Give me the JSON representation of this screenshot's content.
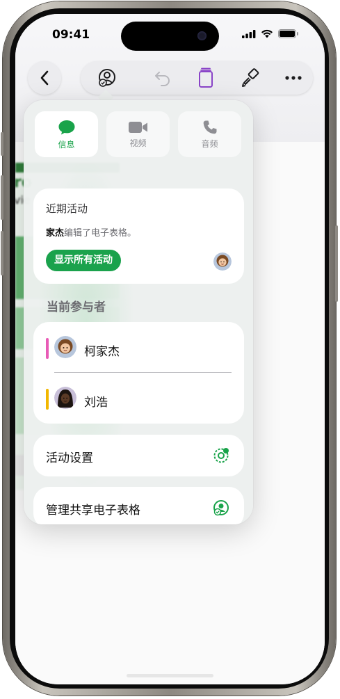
{
  "status_bar": {
    "time": "09:41"
  },
  "toolbar": {
    "back_icon": "chevron-left-icon",
    "items": [
      "collaboration-icon",
      "undo-icon",
      "format-pane-icon",
      "paintbrush-icon",
      "more-icon"
    ]
  },
  "popover": {
    "tabs": [
      {
        "label": "信息",
        "icon": "message-bubble-icon",
        "active": true
      },
      {
        "label": "视频",
        "icon": "video-camera-icon",
        "active": false
      },
      {
        "label": "音频",
        "icon": "phone-icon",
        "active": false
      }
    ],
    "recent_activity": {
      "title": "近期活动",
      "actor": "家杰",
      "action": "编辑了电子表格。",
      "button": "显示所有活动"
    },
    "participants_header": "当前参与者",
    "participants": [
      {
        "name": "柯家杰",
        "color": "#e85bb6"
      },
      {
        "name": "刘浩",
        "color": "#f2b700"
      }
    ],
    "activity_settings": "活动设置",
    "manage_sharing": "管理共享电子表格"
  },
  "colors": {
    "accent_green": "#1aa24c"
  },
  "background_sheet": {
    "title_fragment": "ro",
    "subtitle_fragment": "vie"
  }
}
